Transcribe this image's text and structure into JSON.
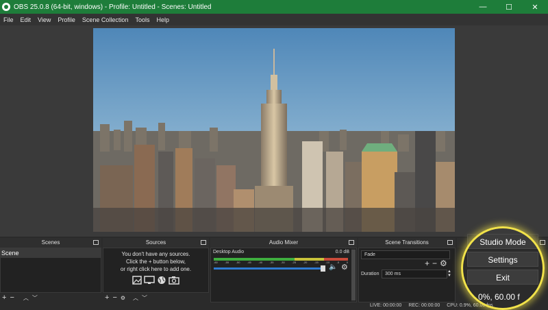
{
  "window": {
    "title": "OBS 25.0.8 (64-bit, windows) - Profile: Untitled - Scenes: Untitled",
    "minimize_glyph": "—",
    "maximize_glyph": "☐",
    "close_glyph": "✕"
  },
  "menu": [
    "File",
    "Edit",
    "View",
    "Profile",
    "Scene Collection",
    "Tools",
    "Help"
  ],
  "docks": {
    "scenes": {
      "title": "Scenes",
      "items": [
        "Scene"
      ]
    },
    "sources": {
      "title": "Sources",
      "empty_line1": "You don't have any sources.",
      "empty_line2": "Click the + button below,",
      "empty_line3": "or right click here to add one."
    },
    "audio_mixer": {
      "title": "Audio Mixer",
      "channel": "Desktop Audio",
      "level": "0.0 dB",
      "scale": [
        "-60",
        "-55",
        "-50",
        "-45",
        "-40",
        "-35",
        "-30",
        "-25",
        "-20",
        "-15",
        "-10",
        "-5",
        "0"
      ]
    },
    "transitions": {
      "title": "Scene Transitions",
      "selected": "Fade",
      "duration_label": "Duration",
      "duration_value": "300 ms"
    }
  },
  "controls": {
    "studio_mode": "Studio Mode",
    "settings": "Settings",
    "exit": "Exit"
  },
  "status": {
    "live": "LIVE: 00:00:00",
    "rec": "REC: 00:00:00",
    "cpu": "CPU: 0.9%, 60.00 fps",
    "fps_overlay": "0%, 60.00 f"
  },
  "colors": {
    "titlebar": "#1e7d3a",
    "highlight": "#f1e24a",
    "meter_green": "#3fae3f",
    "meter_yellow": "#c8c23a",
    "meter_red": "#c84a3a",
    "slider_blue": "#2e7ad1"
  },
  "icons": {
    "add": "+",
    "remove": "−",
    "gear": "⚙",
    "up": "︿",
    "down": "﹀",
    "speaker": "🔈"
  }
}
